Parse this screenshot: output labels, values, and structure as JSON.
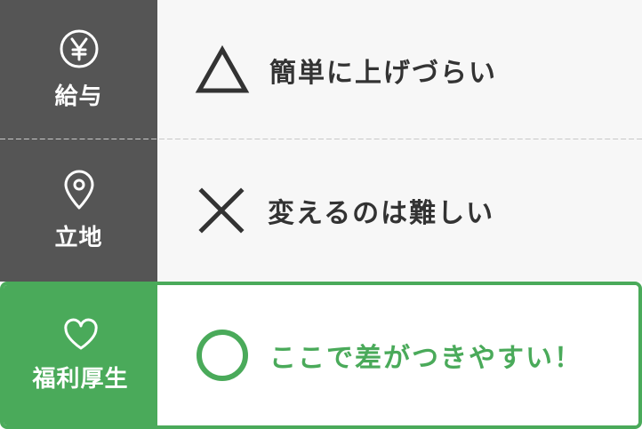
{
  "colors": {
    "label_bg": "#555555",
    "value_bg": "#f7f7f7",
    "highlight": "#4aaa5a",
    "text_dark": "#333333"
  },
  "rows": [
    {
      "label": "給与",
      "label_icon": "yen-circle-icon",
      "mark": "triangle-icon",
      "value": "簡単に上げづらい"
    },
    {
      "label": "立地",
      "label_icon": "location-pin-icon",
      "mark": "cross-icon",
      "value": "変えるのは難しい"
    },
    {
      "label": "福利厚生",
      "label_icon": "heart-icon",
      "mark": "circle-icon",
      "value": "ここで差がつきやすい！"
    }
  ]
}
